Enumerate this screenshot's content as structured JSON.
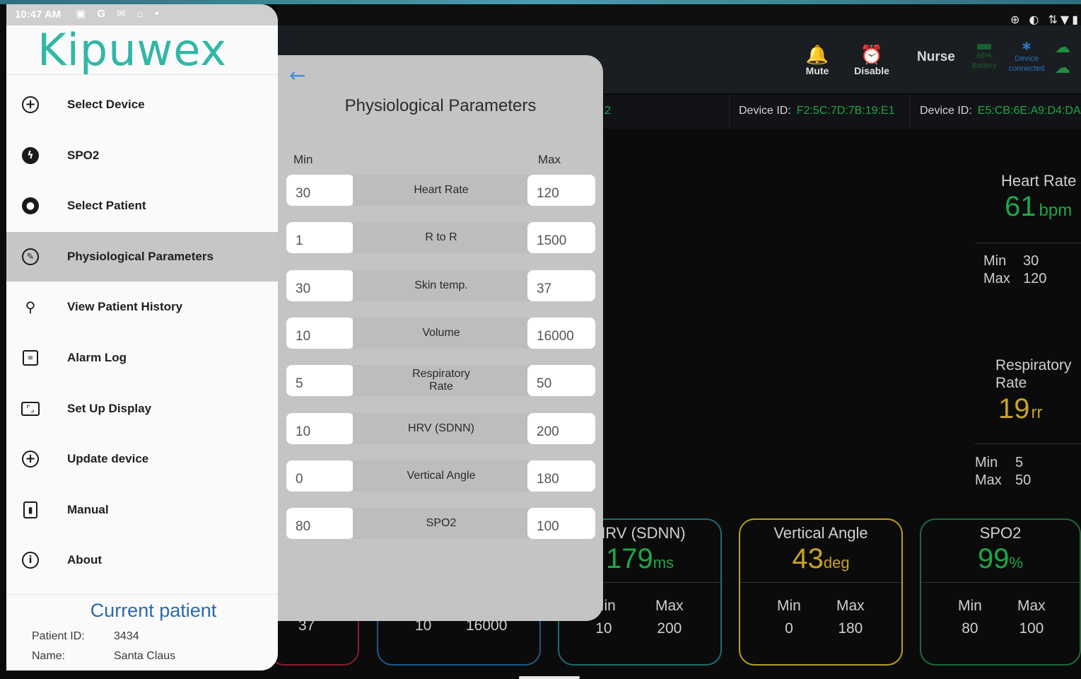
{
  "status": {
    "time": "10:47 AM",
    "left_icons": "▣ G ✉ ⌂ •",
    "right_icons": "⊕ ◐ ⇅▼▮"
  },
  "topbar": {
    "mute": "Mute",
    "disable": "Disable",
    "nurse": "Nurse",
    "battery_pct": "66%",
    "battery": "Battery",
    "device": "Device",
    "connected": "connected"
  },
  "devices": [
    {
      "label": "Device ID:",
      "mac": "F2:5C:7D:7B:19:E1"
    },
    {
      "label": "Device ID:",
      "mac": "E5:CB:6E:A9:D4:DA"
    }
  ],
  "partial_device_digit": "2",
  "right_panel": {
    "heart_rate": {
      "title": "Heart Rate",
      "value": "61",
      "unit": "bpm",
      "min_label": "Min",
      "min": "30",
      "max_label": "Max",
      "max": "120"
    },
    "resp_rate": {
      "title1": "Respiratory",
      "title2": "Rate",
      "value": "19",
      "unit": "rr",
      "min_label": "Min",
      "min": "5",
      "max_label": "Max",
      "max": "50"
    }
  },
  "cards": [
    {
      "title": "HRV (SDNN)",
      "value": "179",
      "unit": "ms",
      "min_label": "Min",
      "max_label": "Max",
      "min": "10",
      "max": "200"
    },
    {
      "title": "Vertical Angle",
      "value": "43",
      "unit": "deg",
      "min_label": "Min",
      "max_label": "Max",
      "min": "0",
      "max": "180"
    },
    {
      "title": "SPO2",
      "value": "99",
      "unit": "%",
      "min_label": "Min",
      "max_label": "Max",
      "min": "80",
      "max": "100"
    }
  ],
  "hidden_cards": {
    "skin_max": "37",
    "vol_min": "10",
    "vol_max": "16000"
  },
  "drawer": {
    "logo": "Kipuwex",
    "items": [
      {
        "label": "Select Device",
        "icon": "plus-circle-icon"
      },
      {
        "label": "SPO2",
        "icon": "bolt-circle-icon"
      },
      {
        "label": "Select Patient",
        "icon": "account-circle-icon"
      },
      {
        "label": "Physiological Parameters",
        "icon": "wrench-circle-icon"
      },
      {
        "label": "View Patient History",
        "icon": "person-search-icon"
      },
      {
        "label": "Alarm Log",
        "icon": "clipboard-icon"
      },
      {
        "label": "Set Up Display",
        "icon": "aspect-ratio-icon"
      },
      {
        "label": "Update device",
        "icon": "plus-circle-icon"
      },
      {
        "label": "Manual",
        "icon": "bookmark-book-icon"
      },
      {
        "label": "About",
        "icon": "info-circle-icon"
      }
    ],
    "current_patient": {
      "title": "Current patient",
      "id_label": "Patient ID:",
      "id": "3434",
      "name_label": "Name:",
      "name": "Santa Claus"
    }
  },
  "dialog": {
    "title": "Physiological Parameters",
    "min_label": "Min",
    "max_label": "Max",
    "params": [
      {
        "name": "Heart Rate",
        "min": "30",
        "max": "120"
      },
      {
        "name": "R to R",
        "min": "1",
        "max": "1500"
      },
      {
        "name": "Skin temp.",
        "min": "30",
        "max": "37"
      },
      {
        "name": "Volume",
        "min": "10",
        "max": "16000"
      },
      {
        "name": "Respiratory Rate",
        "min": "5",
        "max": "50"
      },
      {
        "name": "HRV (SDNN)",
        "min": "10",
        "max": "200"
      },
      {
        "name": "Vertical Angle",
        "min": "0",
        "max": "180"
      },
      {
        "name": "SPO2",
        "min": "80",
        "max": "100"
      }
    ]
  },
  "colors": {
    "accent_green": "#1fa64a",
    "accent_yellow": "#c9a227",
    "logo_teal": "#31b7a5",
    "patient_blue": "#2d6aa8",
    "alarm_orange": "#ff6d3b"
  }
}
